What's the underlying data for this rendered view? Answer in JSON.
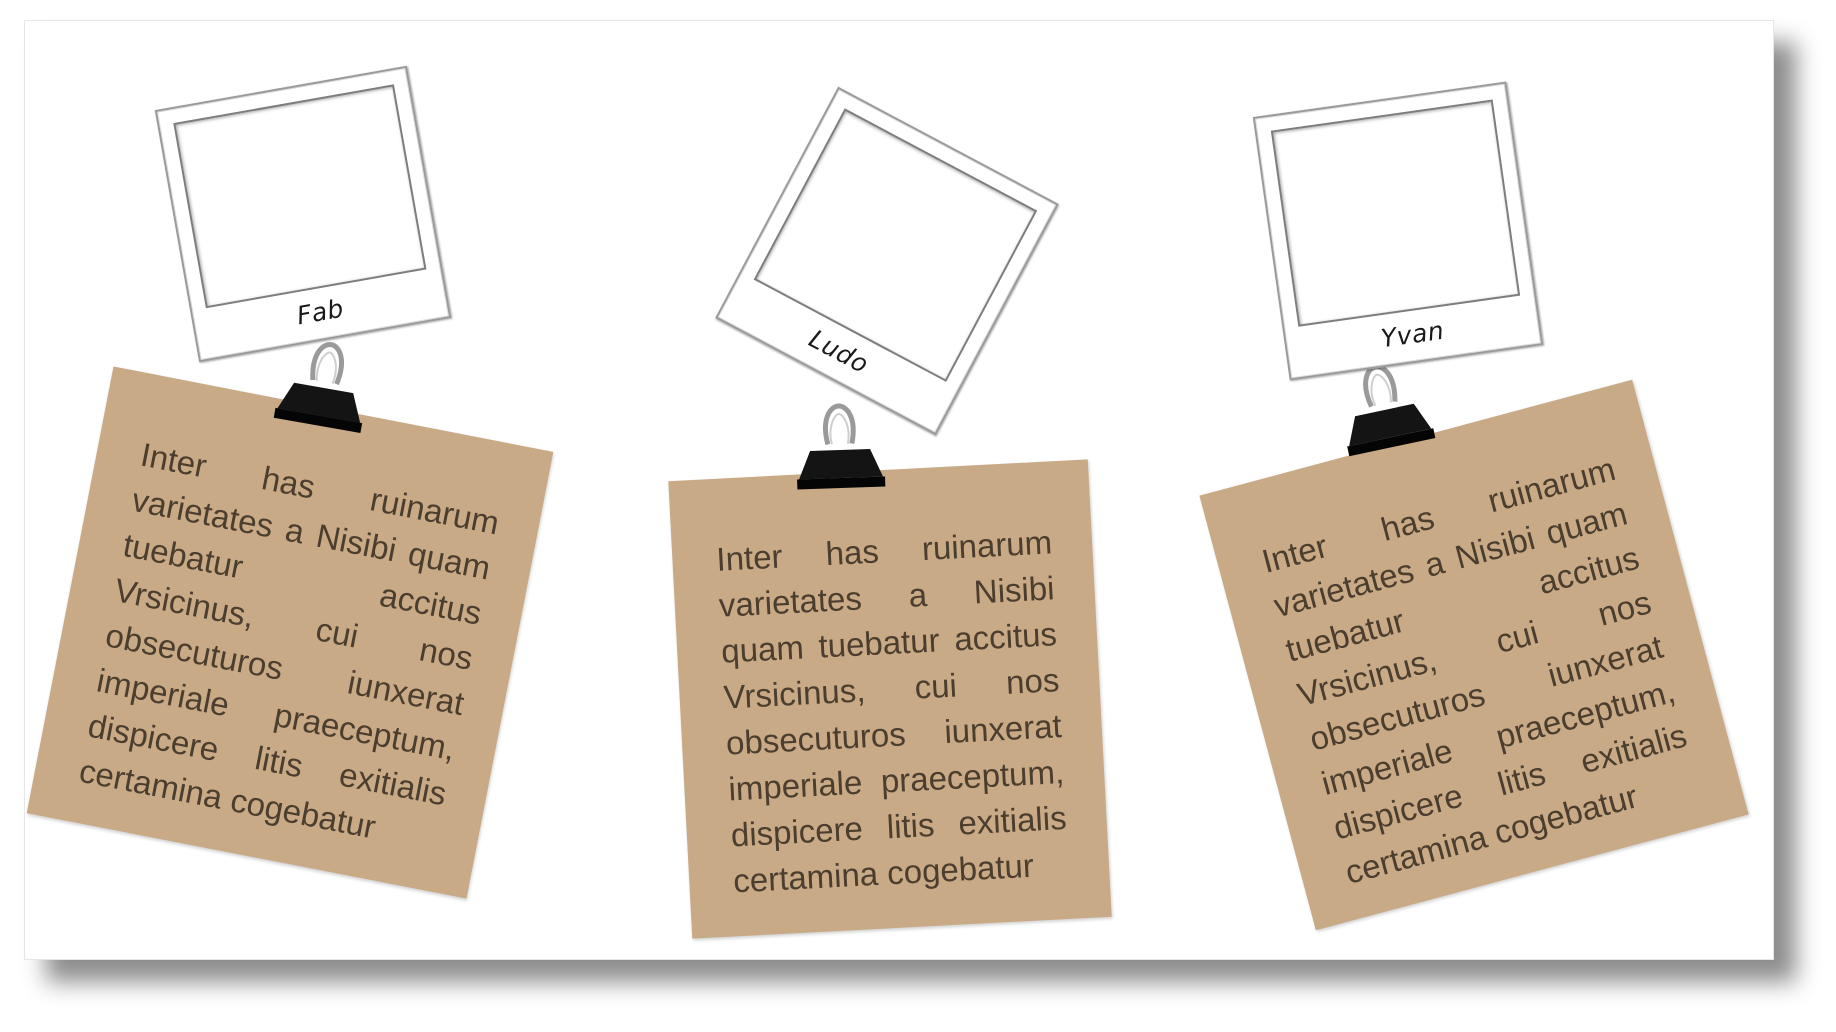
{
  "cards": [
    {
      "name": "Fab",
      "text": "Inter has ruinarum varietates a Nisibi quam tuebatur accitus Vrsicinus, cui nos obsecuturos iunxerat imperiale praeceptum, dispicere litis exitialis certamina cogebatur"
    },
    {
      "name": "Ludo",
      "text": "Inter has ruinarum varietates a Nisibi quam tuebatur accitus Vrsicinus, cui nos obsecuturos iunxerat imperiale praeceptum, dispicere litis exitialis certamina cogebatur"
    },
    {
      "name": "Yvan",
      "text": "Inter has ruinarum varietates a Nisibi quam tuebatur accitus Vrsicinus, cui nos obsecuturos iunxerat imperiale praeceptum, dispicere litis exitialis certamina cogebatur"
    }
  ],
  "icons": {
    "clip": "binder-clip-icon",
    "photo": "photo-frame-icon"
  },
  "colors": {
    "note": "#c8aa86",
    "note_text": "#4b3e2e",
    "clip": "#111111"
  }
}
